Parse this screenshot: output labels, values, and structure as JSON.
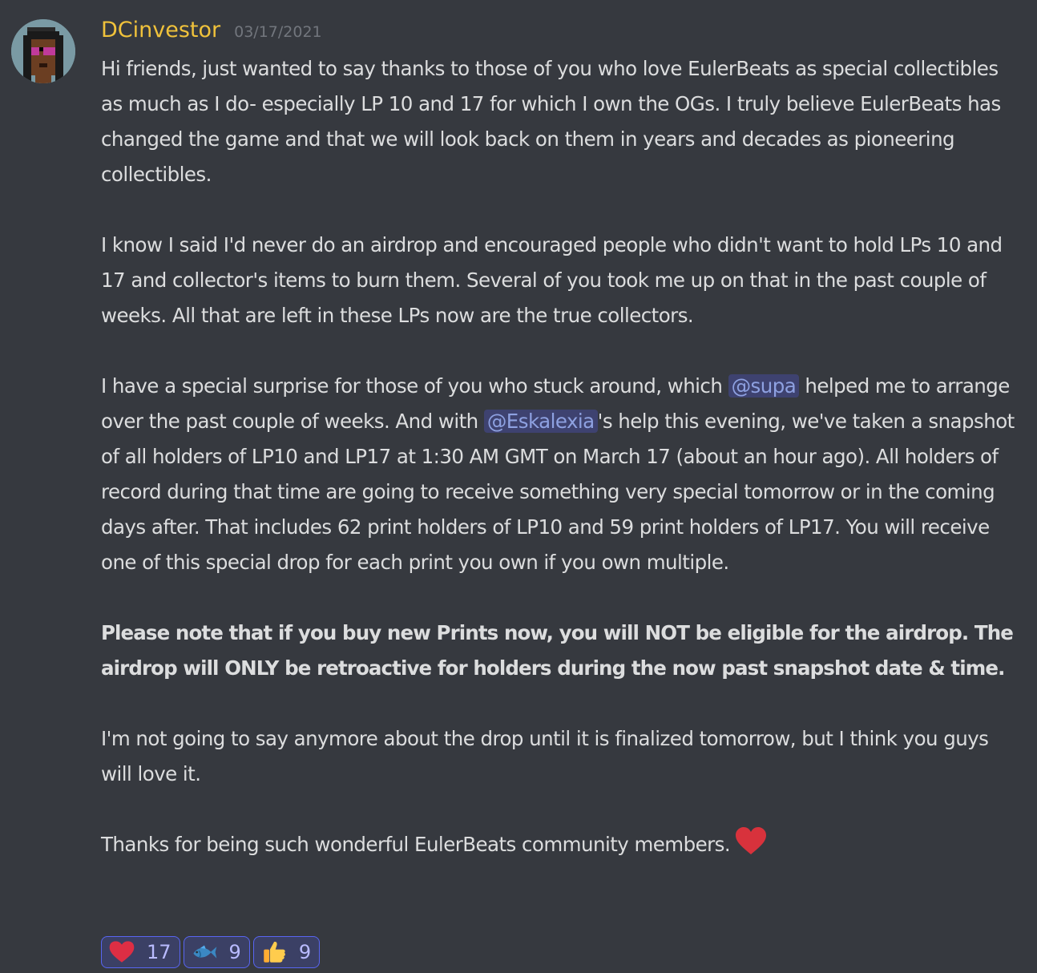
{
  "message": {
    "author": "DCinvestor",
    "timestamp": "03/17/2021",
    "paragraphs": {
      "p1": "Hi friends, just wanted to say thanks to those of you who love EulerBeats as special collectibles as much as I do- especially LP 10 and 17 for which I own the OGs. I truly believe EulerBeats has changed the game and that we will look back on them in years and decades as pioneering collectibles.",
      "p2": "I know I said I'd never do an airdrop and encouraged people who didn't want to hold LPs 10 and 17 and collector's items to burn them. Several of you took me up on that in the past couple of weeks. All that are left in these LPs now are the true collectors.",
      "p3_part1": "I have a special surprise for those of you who stuck around, which ",
      "p3_mention1": "@supa",
      "p3_part2": " helped me to arrange over the past couple of weeks. And with ",
      "p3_mention2": "@Eskalexia",
      "p3_part3": "'s help this evening, we've taken a snapshot of all holders of LP10 and LP17 at 1:30 AM GMT on March 17 (about an hour ago). All holders of record during that time are going to receive something very special tomorrow or in the coming days after. That includes 62 print holders of LP10 and 59 print holders of LP17. You will receive one of this special drop for each print you own if you own multiple.",
      "p4_bold": "Please note that if you buy new Prints now, you will NOT be eligible for the airdrop. The airdrop will ONLY be retroactive for holders during the now past snapshot date & time.",
      "p5": "I'm not going to say anymore about the drop until it is finalized tomorrow, but I think you guys will love it.",
      "p6": "Thanks for being such wonderful EulerBeats community members."
    },
    "inline_emoji": "heart-icon",
    "reactions": [
      {
        "emoji": "heart-icon",
        "count": "17",
        "reacted": true
      },
      {
        "emoji": "fish-icon",
        "count": "9",
        "reacted": true
      },
      {
        "emoji": "thumbs-up-icon",
        "count": "9",
        "reacted": true
      }
    ]
  },
  "colors": {
    "background": "#36393f",
    "username": "#f0c23b",
    "timestamp": "#72767d",
    "text": "#dcddde",
    "mention_bg": "#3e4270",
    "mention_text": "#8ea1e1",
    "reaction_bg": "#3b4065",
    "reaction_border": "#5865f2"
  }
}
